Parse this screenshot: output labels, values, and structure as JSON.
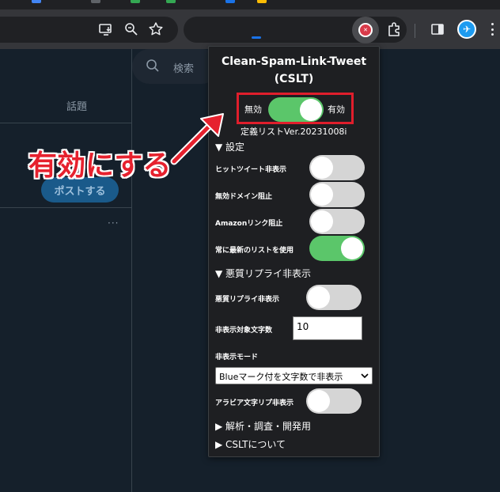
{
  "browser": {
    "toolbar_icons": [
      "install-app-icon",
      "zoom-icon",
      "bookmark-star-icon",
      "extension-cslt-icon",
      "extensions-puzzle-icon",
      "side-panel-icon",
      "profile-icon",
      "menu-icon"
    ]
  },
  "twitter": {
    "topic_label": "話題",
    "post_button": "ポストする",
    "more": "···",
    "search_placeholder": "検索"
  },
  "popup": {
    "title_line1": "Clean-Spam-Link-Tweet",
    "title_line2": "(CSLT)",
    "master_toggle": {
      "off_label": "無効",
      "on_label": "有効",
      "on": true
    },
    "version": "定義リストVer.20231008i",
    "settings_section": "▼ 設定",
    "settings": [
      {
        "label": "ヒットツイート非表示",
        "on": false
      },
      {
        "label": "無効ドメイン阻止",
        "on": false
      },
      {
        "label": "Amazonリンク阻止",
        "on": false
      },
      {
        "label": "常に最新のリストを使用",
        "on": true
      }
    ],
    "reply_section": "▼ 悪質リプライ非表示",
    "reply_hide": {
      "label": "悪質リプライ非表示",
      "on": false
    },
    "char_count": {
      "label": "非表示対象文字数",
      "value": "10"
    },
    "mode": {
      "label": "非表示モード",
      "selected": "Blueマーク付を文字数で非表示"
    },
    "arabic": {
      "label": "アラビア文字リプ非表示",
      "on": false
    },
    "analysis_section": "▶ 解析・調査・開発用",
    "about_section": "▶ CSLTについて"
  },
  "annotation": {
    "text": "有効にする",
    "color": "#e6212e"
  },
  "colors": {
    "toggle_on": "#5bc66a",
    "toggle_off": "#d5d5d5",
    "popup_bg": "#1e1f22",
    "highlight_box": "#e01e2c"
  }
}
